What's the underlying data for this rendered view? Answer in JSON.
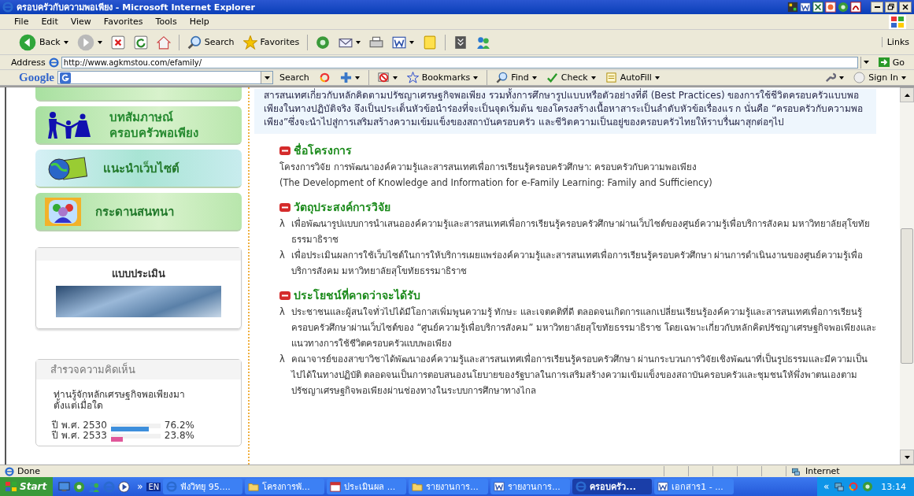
{
  "window": {
    "title": "ครอบครัวกับความพอเพียง - Microsoft Internet Explorer"
  },
  "title_bar_icons": [
    {
      "kind": "app"
    },
    {
      "kind": "word"
    },
    {
      "kind": "excel"
    },
    {
      "kind": "ppt"
    },
    {
      "kind": "media"
    },
    {
      "kind": "pdf"
    }
  ],
  "window_controls": [
    {
      "kind": "minimize"
    },
    {
      "kind": "maximize"
    },
    {
      "kind": "close"
    }
  ],
  "menu": [
    "File",
    "Edit",
    "View",
    "Favorites",
    "Tools",
    "Help"
  ],
  "toolbar": [
    {
      "kind": "back",
      "label": "Back",
      "dropdown": true
    },
    {
      "kind": "forward",
      "dropdown": true
    },
    {
      "kind": "stop",
      "dropdown": false
    },
    {
      "kind": "refresh",
      "dropdown": false
    },
    {
      "kind": "home",
      "dropdown": false
    },
    {
      "kind": "search",
      "label": "Search",
      "dropdown": false
    },
    {
      "kind": "favorites",
      "label": "Favorites",
      "dropdown": false
    },
    {
      "kind": "media",
      "dropdown": false
    },
    {
      "kind": "mail",
      "dropdown": true
    },
    {
      "kind": "print",
      "dropdown": false
    },
    {
      "kind": "word",
      "dropdown": true
    },
    {
      "kind": "note",
      "dropdown": false
    },
    {
      "kind": "research",
      "dropdown": false
    },
    {
      "kind": "messenger",
      "dropdown": false
    }
  ],
  "links": "Links",
  "address": {
    "label": "Address",
    "value": "http://www.agkmstou.com/efamily/",
    "go": "Go"
  },
  "google_bar": {
    "logo": "Google",
    "buttons": [
      {
        "kind": "search",
        "label": "Search",
        "dropdown": false
      },
      {
        "kind": "pagerank",
        "dropdown": false
      },
      {
        "kind": "add",
        "dropdown": true
      },
      {
        "kind": "popup",
        "dropdown": true
      },
      {
        "kind": "star",
        "label": "Bookmarks",
        "dropdown": true
      },
      {
        "kind": "find",
        "label": "Find",
        "dropdown": true
      },
      {
        "kind": "spell",
        "label": "Check",
        "dropdown": true
      },
      {
        "kind": "autofill",
        "label": "AutoFill",
        "dropdown": true
      }
    ],
    "right": [
      {
        "kind": "wrench",
        "dropdown": true
      },
      {
        "kind": "signin",
        "label": "Sign In",
        "dropdown": true
      }
    ]
  },
  "sidebar": {
    "menu": [
      {
        "kind": "family",
        "label_lines": [
          "บทสัมภาษณ์",
          "ครอบครัวพอเพียง"
        ]
      },
      {
        "kind": "globe",
        "label_lines": [
          "แนะนำเว็บไซต์"
        ]
      },
      {
        "kind": "chat",
        "label_lines": [
          "กระดานสนทนา"
        ]
      }
    ],
    "evaluation": {
      "title": "แบบประเมิน"
    },
    "poll": {
      "title": "สำรวจความคิดเห็น",
      "question": "ท่านรู้จักหลักเศรษฐกิจพอเพียงมาตั้งแต่เมื่อใด",
      "options": [
        {
          "label": "ปี พ.ศ. 2530",
          "level": 0.762,
          "percent": "76.2%",
          "color": "#3d8fdc"
        },
        {
          "label": "ปี พ.ศ. 2533",
          "level": 0.238,
          "percent": "23.8%",
          "color": "#e0579a"
        }
      ]
    }
  },
  "intro": "สารสนเทศเกี่ยวกับหลักคิดตามปรัชญาเศรษฐกิจพอเพียง รวมทั้งการศึกษารูปแบบหรือตัวอย่างที่ดี (Best Practices) ของการใช้ชีวิตครอบครัวแบบพอเพียงในทางปฏิบัติจริง จึงเป็นประเด็นหัวข้อนำร่องที่จะเป็นจุดเริ่มต้น ของโครงสร้างเนื้อหาสาระเป็นลำดับหัวข้อเรื่องแร ก นั่นคือ “ครอบครัวกับความพอเพียง”ซึ่งจะนำไปสู่การเสริมสร้างความเข้มแข็งของสถาบันครอบครัว และชีวิตความเป็นอยู่ของครอบครัวไทยให้ราบรื่นผาสุกต่อๆไป",
  "sections": [
    {
      "kind": "plain",
      "heading": "ชื่อโครงการ",
      "items": [
        "โครงการวิจัย การพัฒนาองค์ความรู้และสารสนเทศเพื่อการเรียนรู้ครอบครัวศึกษา: ครอบครัวกับความพอเพียง",
        "(The  Development of Knowledge and Information for e-Family Learning:  Family and Sufficiency)"
      ]
    },
    {
      "kind": "bullets",
      "heading": "วัตถุประสงค์การวิจัย",
      "items": [
        {
          "marker": "λ",
          "text": "เพื่อพัฒนารูปแบบการนำเสนอองค์ความรู้และสารสนเทศเพื่อการเรียนรู้ครอบครัวศึกษาผ่านเว็บไซต์ของศูนย์ความรู้เพื่อบริการสังคม มหาวิทยาลัยสุโขทัยธรรมาธิราช"
        },
        {
          "marker": "λ",
          "text": "เพื่อประเมินผลการใช้เว็บไซต์ในการให้บริการเผยแพร่องค์ความรู้และสารสนเทศเพื่อการเรียนรู้ครอบครัวศึกษา ผ่านการดำเนินงานของศูนย์ความรู้เพื่อบริการสังคม มหาวิทยาลัยสุโขทัยธรรมาธิราช"
        }
      ]
    },
    {
      "kind": "bullets",
      "heading": "ประโยชน์ที่คาดว่าจะได้รับ",
      "items": [
        {
          "marker": "λ",
          "text": "ประชาชนและผู้สนใจทั่วไปได้มีโอกาสเพิ่มพูนความรู้ ทักษะ และเจตคติที่ดี ตลอดจนเกิดการแลกเปลี่ยนเรียนรู้องค์ความรู้และสารสนเทศเพื่อการเรียนรู้ครอบครัวศึกษาผ่านเว็บไซต์ของ “ศูนย์ความรู้เพื่อบริการสังคม” มหาวิทยาลัยสุโขทัยธรรมาธิราช โดยเฉพาะเกี่ยวกับหลักคิดปรัชญาเศรษฐกิจพอเพียงและแนวทางการใช้ชีวิตครอบครัวแบบพอเพียง"
        },
        {
          "marker": "λ",
          "text": "คณาจารย์ของสาขาวิชาได้พัฒนาองค์ความรู้และสารสนเทศเพื่อการเรียนรู้ครอบครัวศึกษา ผ่านกระบวนการวิจัยเชิงพัฒนาที่เป็นรูปธรรมและมีความเป็นไปได้ในทางปฏิบัติ ตลอดจนเป็นการตอบสนองนโยบายของรัฐบาลในการเสริมสร้างความเข้มแข็งของสถาบันครอบครัวและชุมชนให้พึ่งพาตนเองตามปรัชญาเศรษฐกิจพอเพียงผ่านช่องทางในระบบการศึกษาทางไกล"
        }
      ]
    }
  ],
  "status_bar": {
    "text": "Done",
    "zone": "Internet"
  },
  "taskbar": {
    "start": "Start",
    "quick_launch": [
      {
        "kind": "desktop"
      },
      {
        "kind": "media"
      },
      {
        "kind": "messenger"
      },
      {
        "kind": "ie"
      },
      {
        "kind": "player"
      }
    ],
    "more": "»",
    "language": "EN",
    "tasks": [
      {
        "kind": "ie",
        "label": "ฟังวิทยุ 95....",
        "selected": false
      },
      {
        "kind": "folder",
        "label": "โครงการพั...",
        "selected": false
      },
      {
        "kind": "calendar",
        "label": "ประเมินผล ...",
        "selected": false
      },
      {
        "kind": "folder",
        "label": "รายงานการ...",
        "selected": false
      },
      {
        "kind": "word",
        "label": "รายงานการ...",
        "selected": false
      },
      {
        "kind": "ie",
        "label": "ครอบครัว...",
        "selected": true
      },
      {
        "kind": "word",
        "label": "เอกสาร1 - ...",
        "selected": false
      }
    ],
    "tray_toggle": "«",
    "tray": [
      {
        "kind": "network"
      },
      {
        "kind": "chrome"
      },
      {
        "kind": "media"
      }
    ],
    "clock": "13:14"
  }
}
